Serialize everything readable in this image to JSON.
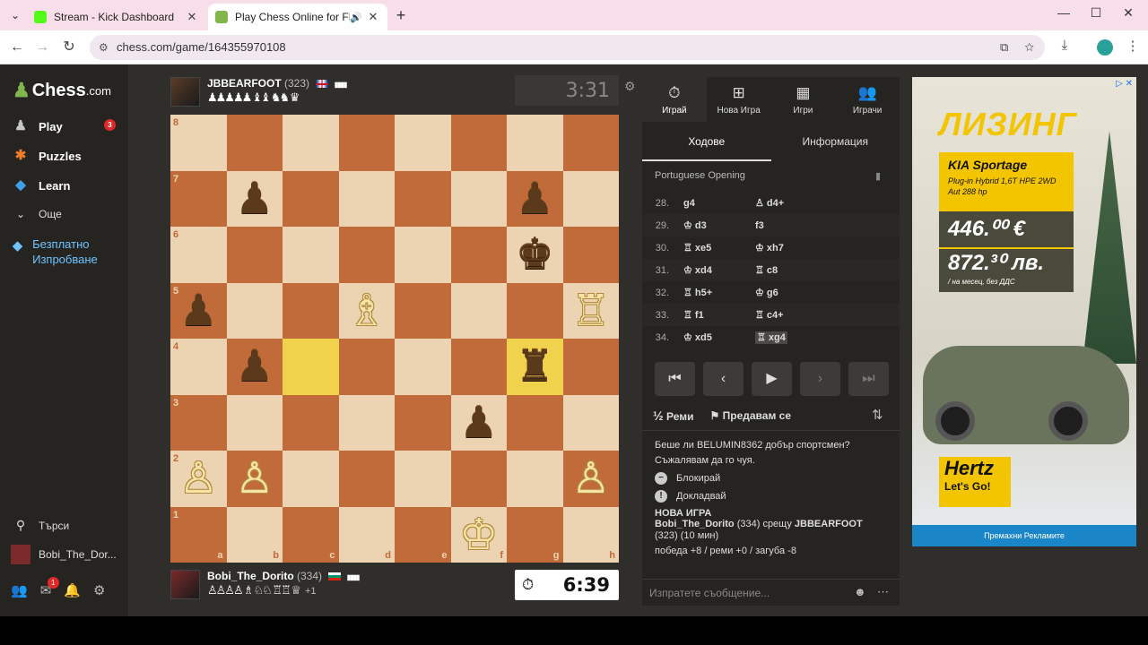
{
  "browser": {
    "tabs": [
      {
        "title": "Stream - Kick Dashboard",
        "favicon_color": "#53fc18"
      },
      {
        "title": "Play Chess Online for FREE",
        "favicon_color": "#81b64c"
      }
    ],
    "url": "chess.com/game/164355970108"
  },
  "sidebar": {
    "logo": "Chess",
    "logo_suffix": ".com",
    "items": [
      {
        "label": "Play",
        "icon": "pawn-icon",
        "badge": "3"
      },
      {
        "label": "Puzzles",
        "icon": "puzzle-icon"
      },
      {
        "label": "Learn",
        "icon": "learn-icon"
      }
    ],
    "more": "Още",
    "trial": "Безплатно Изпробване",
    "search": "Търси",
    "username": "Bobi_The_Dor...",
    "mail_badge": "1"
  },
  "top_player": {
    "name": "JBBEARFOOT",
    "rating": "(323)",
    "captured": "♟♟♟♟♟ ♝♝ ♞♞ ♛",
    "clock": "3:31"
  },
  "bottom_player": {
    "name": "Bobi_The_Dorito",
    "rating": "(334)",
    "captured": "♙♙♙♙ ♗ ♘♘ ♖♖ ♕",
    "diff": "+1",
    "clock": "6:39"
  },
  "board": {
    "ranks": [
      "8",
      "7",
      "6",
      "5",
      "4",
      "3",
      "2",
      "1"
    ],
    "files": [
      "a",
      "b",
      "c",
      "d",
      "e",
      "f",
      "g",
      "h"
    ],
    "highlight": [
      "c4",
      "g4"
    ],
    "pieces": [
      {
        "sq": "b7",
        "p": "♟",
        "c": "b"
      },
      {
        "sq": "g7",
        "p": "♟",
        "c": "b"
      },
      {
        "sq": "g6",
        "p": "♚",
        "c": "b"
      },
      {
        "sq": "a5",
        "p": "♟",
        "c": "b"
      },
      {
        "sq": "b4",
        "p": "♟",
        "c": "b"
      },
      {
        "sq": "g4",
        "p": "♜",
        "c": "b"
      },
      {
        "sq": "f3",
        "p": "♟",
        "c": "b"
      },
      {
        "sq": "d5",
        "p": "♗",
        "c": "w"
      },
      {
        "sq": "h5",
        "p": "♖",
        "c": "w"
      },
      {
        "sq": "a2",
        "p": "♙",
        "c": "w"
      },
      {
        "sq": "b2",
        "p": "♙",
        "c": "w"
      },
      {
        "sq": "h2",
        "p": "♙",
        "c": "w"
      },
      {
        "sq": "f1",
        "p": "♔",
        "c": "w"
      }
    ]
  },
  "panel": {
    "tabs": [
      {
        "label": "Играй",
        "icon": "stopwatch-icon"
      },
      {
        "label": "Нова Игра",
        "icon": "plus-icon"
      },
      {
        "label": "Игри",
        "icon": "board-icon"
      },
      {
        "label": "Играчи",
        "icon": "players-icon"
      }
    ],
    "subtabs": [
      "Ходове",
      "Информация"
    ],
    "opening": "Portuguese Opening",
    "moves": [
      {
        "n": "28.",
        "w": "g4",
        "b": "♙ d4+"
      },
      {
        "n": "29.",
        "w": "♔ d3",
        "b": "f3"
      },
      {
        "n": "30.",
        "w": "♖ xe5",
        "b": "♔ xh7"
      },
      {
        "n": "31.",
        "w": "♔ xd4",
        "b": "♖ c8"
      },
      {
        "n": "32.",
        "w": "♖ h5+",
        "b": "♔ g6"
      },
      {
        "n": "33.",
        "w": "♖ f1",
        "b": "♖ c4+"
      },
      {
        "n": "34.",
        "w": "♔ xd5",
        "b": "♖ xg4"
      }
    ],
    "draw": "Реми",
    "resign": "Предавам се",
    "chat": {
      "q": "Беше ли BELUMIN8362 добър спортсмен?",
      "sorry": "Съжалявам да го чуя.",
      "block": "Блокирай",
      "report": "Докладвай",
      "new_game": "НОВА ИГРА",
      "match_p1": "Bobi_The_Dorito",
      "match_r1": "(334)",
      "vs": "срещу",
      "match_p2": "JBBEARFOOT",
      "match_r2": "(323)",
      "duration": "(10 мин)",
      "stats": "победа +8 / реми +0 / загуба -8"
    },
    "chat_placeholder": "Изпратете съобщение..."
  },
  "ad": {
    "title": "ЛИЗИНГ",
    "model": "KIA Sportage",
    "spec": "Plug-in Hybrid 1,6T HPE 2WD Aut 288 hp",
    "price_eur": "446.⁰⁰ €",
    "price_lv": "872.³⁰ лв.",
    "price_note": "/ на месец, без ДДС",
    "brand": "Hertz",
    "cta": "Let's Go!",
    "remove": "Премахни Рекламите"
  }
}
